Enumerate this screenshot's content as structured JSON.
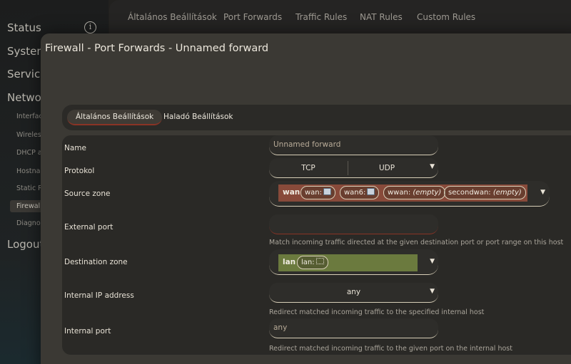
{
  "sidebar": {
    "main_items": [
      "Status",
      "System",
      "Services",
      "Network",
      "Logout"
    ],
    "sub_items": [
      "Interfaces",
      "Wireless",
      "DHCP and DNS",
      "Hostnames",
      "Static Routes",
      "Firewall",
      "Diagnostics"
    ],
    "active_sub": "Firewall"
  },
  "top_tabs": [
    "Általános Beállítások",
    "Port Forwards",
    "Traffic Rules",
    "NAT Rules",
    "Custom Rules"
  ],
  "modal": {
    "title": "Firewall - Port Forwards - Unnamed forward",
    "section_tabs": [
      "Általános Beállítások",
      "Haladó Beállítások"
    ],
    "fields": {
      "name": {
        "label": "Name",
        "value": "Unnamed forward"
      },
      "protocol": {
        "label": "Protokol",
        "options": [
          "TCP",
          "UDP"
        ]
      },
      "source_zone": {
        "label": "Source zone",
        "zone": "wan",
        "networks": [
          "wan:",
          "wan6:",
          "wwan:",
          "secondwan:"
        ],
        "empty_label": "(empty)"
      },
      "external_port": {
        "label": "External port",
        "value": "",
        "hint": "Match incoming traffic directed at the given destination port or port range on this host"
      },
      "destination_zone": {
        "label": "Destination zone",
        "zone": "lan",
        "networks": [
          "lan:"
        ]
      },
      "internal_ip": {
        "label": "Internal IP address",
        "value": "any",
        "hint": "Redirect matched incoming traffic to the specified internal host"
      },
      "internal_port": {
        "label": "Internal port",
        "placeholder": "any",
        "hint": "Redirect matched incoming traffic to the given port on the internal host"
      }
    }
  },
  "colors": {
    "wan_zone": "#884a3a",
    "lan_zone": "#6b7a3e",
    "accent_underline": "#8a3325"
  }
}
